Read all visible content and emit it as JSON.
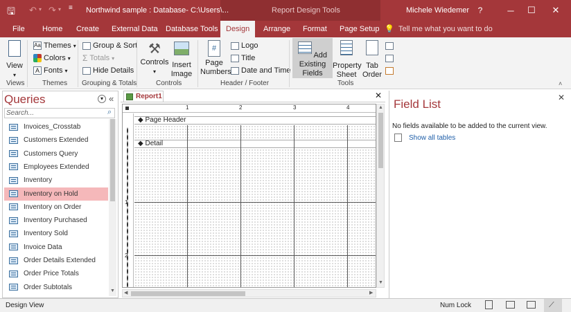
{
  "titlebar": {
    "document_title": "Northwind sample : Database- C:\\Users\\...",
    "context_title": "Report Design Tools",
    "user": "Michele Wiedemer",
    "help": "?",
    "minimize": "─",
    "maximize": "☐",
    "close": "✕"
  },
  "tabs": [
    {
      "label": "File"
    },
    {
      "label": "Home"
    },
    {
      "label": "Create"
    },
    {
      "label": "External Data"
    },
    {
      "label": "Database Tools"
    },
    {
      "label": "Design"
    },
    {
      "label": "Arrange"
    },
    {
      "label": "Format"
    },
    {
      "label": "Page Setup"
    }
  ],
  "tell_me": "Tell me what you want to do",
  "ribbon": {
    "views": {
      "view_label": "View",
      "group_label": "Views"
    },
    "themes": {
      "themes_label": "Themes",
      "colors_label": "Colors",
      "fonts_label": "Fonts",
      "group_label": "Themes"
    },
    "grouping": {
      "group_sort_label": "Group & Sort",
      "totals_label": "Totals",
      "hide_details_label": "Hide Details",
      "group_label": "Grouping & Totals"
    },
    "controls": {
      "controls_label": "Controls",
      "insert_image_label": "Insert Image",
      "group_label": "Controls"
    },
    "header_footer": {
      "page_numbers_label": "Page Numbers",
      "logo_label": "Logo",
      "title_label": "Title",
      "date_time_label": "Date and Time",
      "group_label": "Header / Footer"
    },
    "tools": {
      "add_existing_label": "Add Existing Fields",
      "property_sheet_label": "Property Sheet",
      "tab_order_label": "Tab Order",
      "group_label": "Tools"
    }
  },
  "nav": {
    "title": "Queries",
    "search_placeholder": "Search...",
    "items": [
      {
        "label": "Invoices_Crosstab"
      },
      {
        "label": "Customers Extended"
      },
      {
        "label": "Customers Query"
      },
      {
        "label": "Employees Extended"
      },
      {
        "label": "Inventory"
      },
      {
        "label": "Inventory on Hold"
      },
      {
        "label": "Inventory on Order"
      },
      {
        "label": "Inventory Purchased"
      },
      {
        "label": "Inventory Sold"
      },
      {
        "label": "Invoice Data"
      },
      {
        "label": "Order Details Extended"
      },
      {
        "label": "Order Price Totals"
      },
      {
        "label": "Order Subtotals"
      }
    ],
    "selected_index": 5
  },
  "document": {
    "tab_label": "Report1",
    "ruler_numbers": [
      "1",
      "2",
      "3",
      "4"
    ],
    "vruler_numbers": [
      "1",
      "2"
    ],
    "page_header_label": "Page Header",
    "detail_label": "Detail"
  },
  "field_list": {
    "title": "Field List",
    "message": "No fields available to be added to the current view.",
    "show_all_label": "Show all tables"
  },
  "status": {
    "left": "Design View",
    "num_lock": "Num Lock"
  },
  "colors": {
    "accent": "#a4373a",
    "selected_item": "#f5b8ba"
  }
}
